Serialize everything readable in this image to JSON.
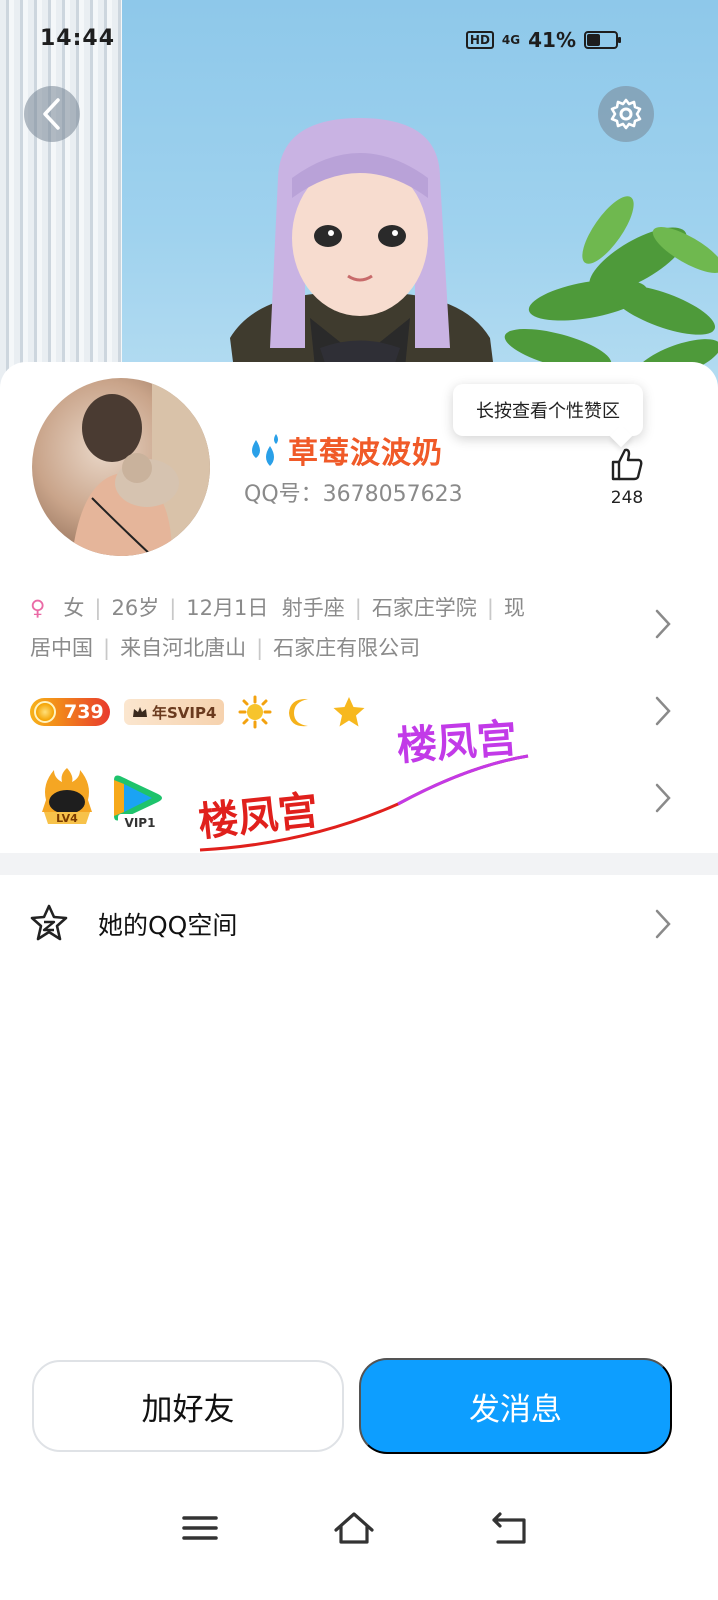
{
  "status_bar": {
    "time": "14:44",
    "hd": "HD",
    "network": "4G",
    "battery": "41%",
    "battery_level": 0.41
  },
  "header": {
    "back_icon": "chevron-left-icon",
    "settings_icon": "gear-icon"
  },
  "profile": {
    "nickname": "草莓波波奶",
    "qq_number": "QQ号：3678057623",
    "like_tooltip": "长按查看个性赞区",
    "like_count": "248",
    "info_line_1": [
      "♀",
      "女",
      "26岁",
      "12月1日",
      "射手座",
      "石家庄学院",
      "现"
    ],
    "info_line_2": [
      "居中国",
      "来自河北唐山",
      "石家庄有限公司"
    ]
  },
  "badges": {
    "level": "739",
    "svip": "年SVIP4",
    "icons": [
      "sun-icon",
      "moon-icon",
      "star-icon"
    ]
  },
  "apps": {
    "lv_badge": "LV4",
    "vip_badge": "VIP1",
    "watermark": [
      "楼凤宫",
      "楼凤宫"
    ]
  },
  "qzone": {
    "label": "她的QQ空间",
    "icon": "qzone-star-icon"
  },
  "actions": {
    "add_friend": "加好友",
    "send_message": "发消息"
  },
  "colors": {
    "accent": "#0d9eff",
    "name": "#f05a28",
    "watermark_red": "#e0201c",
    "watermark_purple": "#c23ae8"
  }
}
